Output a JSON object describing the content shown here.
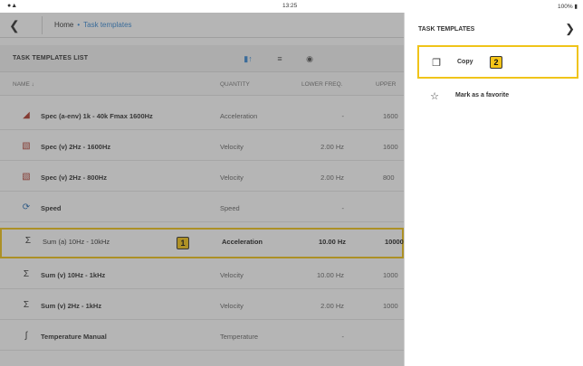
{
  "statusbar": {
    "time": "13:25",
    "battery": "100%"
  },
  "navbar": {
    "home": "Home",
    "separator": "•",
    "current": "Task templates"
  },
  "list": {
    "title": "TASK TEMPLATES LIST",
    "columns": {
      "name": "NAME",
      "quantity": "QUANTITY",
      "lower_freq": "LOWER FREQ.",
      "upper": "UPPER"
    },
    "rows": [
      {
        "icon": "spectrum-env-icon",
        "name": "Spec (a-env) 1k - 40k  Fmax 1600Hz",
        "quantity": "Acceleration",
        "lower": "-",
        "upper": "1600"
      },
      {
        "icon": "spectrum-icon",
        "name": "Spec (v) 2Hz - 1600Hz",
        "quantity": "Velocity",
        "lower": "2.00 Hz",
        "upper": "1600"
      },
      {
        "icon": "spectrum-icon",
        "name": "Spec (v) 2Hz - 800Hz",
        "quantity": "Velocity",
        "lower": "2.00 Hz",
        "upper": "800"
      },
      {
        "icon": "speed-icon",
        "name": "Speed",
        "quantity": "Speed",
        "lower": "-",
        "upper": ""
      },
      {
        "icon": "sum-icon",
        "name": "Sum (a) 10Hz - 10kHz",
        "quantity": "Acceleration",
        "lower": "10.00 Hz",
        "upper": "10000"
      },
      {
        "icon": "sum-icon",
        "name": "Sum (v) 10Hz - 1kHz",
        "quantity": "Velocity",
        "lower": "10.00 Hz",
        "upper": "1000"
      },
      {
        "icon": "sum-icon",
        "name": "Sum (v) 2Hz - 1kHz",
        "quantity": "Velocity",
        "lower": "2.00 Hz",
        "upper": "1000"
      },
      {
        "icon": "thermometer-icon",
        "name": "Temperature Manual",
        "quantity": "Temperature",
        "lower": "-",
        "upper": ""
      }
    ]
  },
  "badges": {
    "row": "1",
    "copy": "2"
  },
  "panel": {
    "title": "TASK TEMPLATES",
    "options": [
      {
        "icon": "copy-icon",
        "label": "Copy"
      },
      {
        "icon": "star-outline-icon",
        "label": "Mark as a favorite"
      }
    ]
  },
  "colors": {
    "highlight": "#f0c419",
    "badge": "#f5c518",
    "accent": "#3a8ad3",
    "icon_red": "#b03b2e"
  }
}
